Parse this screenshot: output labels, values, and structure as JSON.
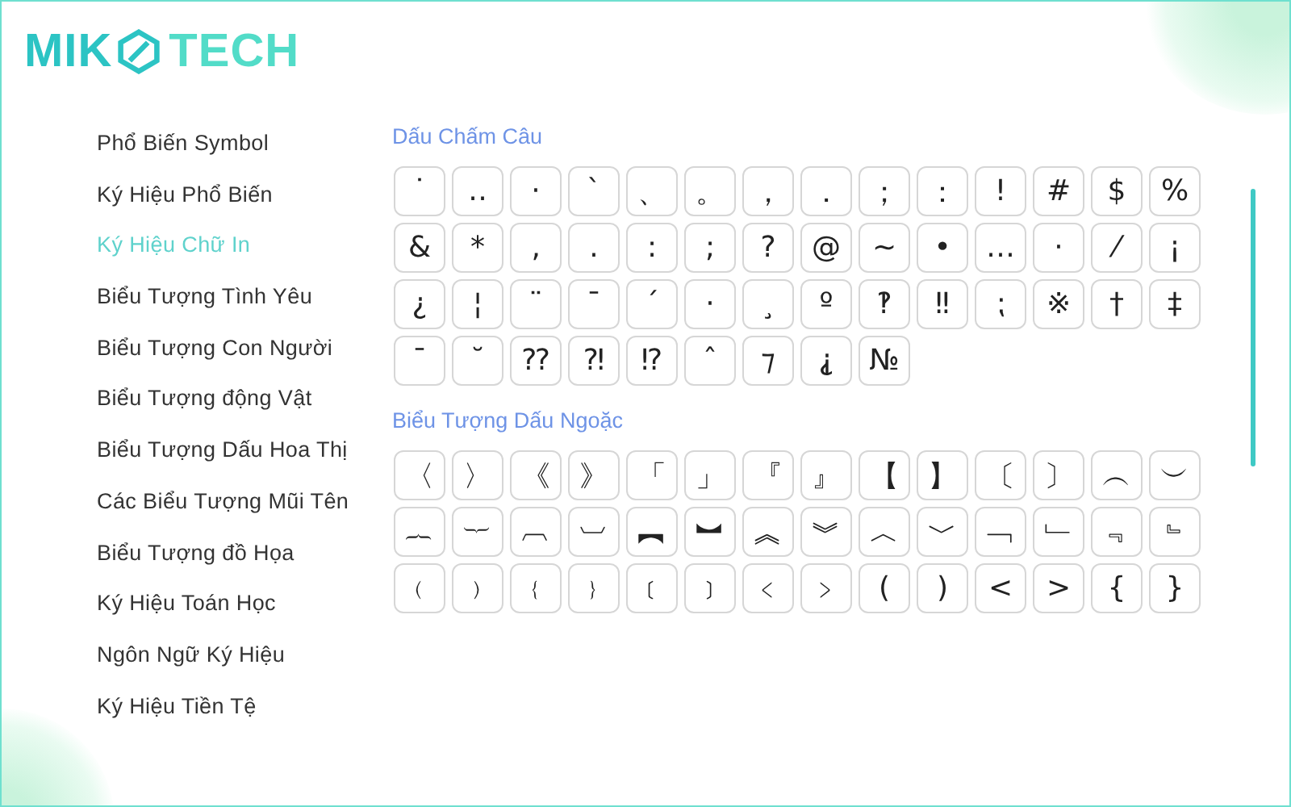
{
  "logo": {
    "left": "MIK",
    "right": "TECH"
  },
  "sidebar": {
    "items": [
      {
        "label": "Phổ Biến Symbol",
        "selected": false
      },
      {
        "label": "Ký Hiệu Phổ Biến",
        "selected": false
      },
      {
        "label": "Ký Hiệu Chữ In",
        "selected": true
      },
      {
        "label": "Biểu Tượng Tình Yêu",
        "selected": false
      },
      {
        "label": "Biểu Tượng Con Người",
        "selected": false
      },
      {
        "label": "Biểu Tượng động Vật",
        "selected": false
      },
      {
        "label": "Biểu Tượng Dấu Hoa Thị",
        "selected": false
      },
      {
        "label": "Các Biểu Tượng Mũi Tên",
        "selected": false
      },
      {
        "label": "Biểu Tượng đồ Họa",
        "selected": false
      },
      {
        "label": "Ký Hiệu Toán Học",
        "selected": false
      },
      {
        "label": "Ngôn Ngữ Ký Hiệu",
        "selected": false
      },
      {
        "label": "Ký Hiệu Tiền Tệ",
        "selected": false
      }
    ]
  },
  "sections": [
    {
      "title": "Dấu Chấm Câu",
      "symbols": [
        "˙",
        "‥",
        "·",
        "ˋ",
        "、",
        "。",
        "，",
        "．",
        "；",
        "：",
        "!",
        "#",
        "$",
        "%",
        "&",
        "*",
        "‚",
        ".",
        ":",
        ";",
        "?",
        "@",
        "~",
        "•",
        "…",
        "·",
        "⁄",
        "¡",
        "¿",
        "¦",
        "¨",
        "¯",
        "´",
        "·",
        "¸",
        "º",
        "‽",
        "‼",
        "⁏",
        "※",
        "†",
        "‡",
        "ˉ",
        "˘",
        "⁇",
        "⁈",
        "⁉",
        "ˆ",
        "⁊",
        "⸘",
        "№"
      ]
    },
    {
      "title": "Biểu Tượng Dấu Ngoặc",
      "symbols": [
        "〈",
        "〉",
        "《",
        "》",
        "「",
        "」",
        "『",
        "』",
        "【",
        "】",
        "〔",
        "〕",
        "︵",
        "︶",
        "︷",
        "︸",
        "︹",
        "︺",
        "︻",
        "︼",
        "︽",
        "︾",
        "︿",
        "﹀",
        "﹁",
        "﹂",
        "﹃",
        "﹄",
        "﹙",
        "﹚",
        "﹛",
        "﹜",
        "﹝",
        "﹞",
        "﹤",
        "﹥",
        "(",
        ")",
        "<",
        ">",
        "{",
        "}"
      ]
    }
  ]
}
